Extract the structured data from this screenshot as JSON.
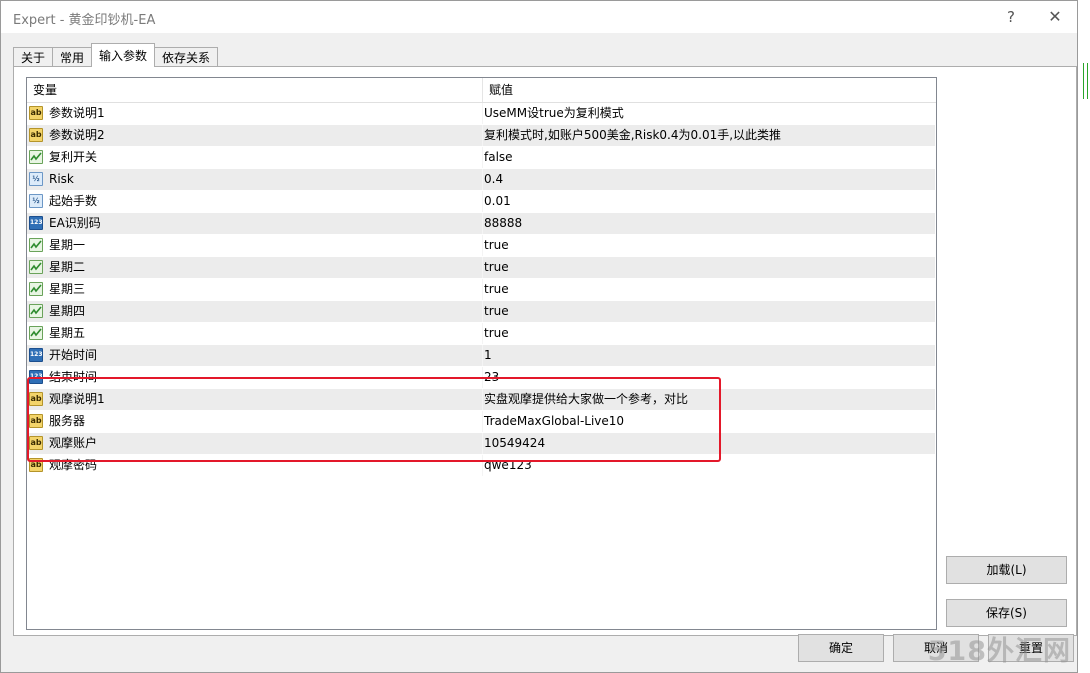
{
  "window": {
    "title": "Expert - 黄金印钞机-EA",
    "help": "?",
    "close": "✕"
  },
  "tabs": [
    {
      "label": "关于",
      "active": false
    },
    {
      "label": "常用",
      "active": false
    },
    {
      "label": "输入参数",
      "active": true
    },
    {
      "label": "依存关系",
      "active": false
    }
  ],
  "table": {
    "headers": {
      "variable": "变量",
      "value": "赋值"
    },
    "rows": [
      {
        "type": "ab-icon",
        "name": "参数说明1",
        "value": "UseMM设true为复利模式"
      },
      {
        "type": "ab-icon",
        "name": "参数说明2",
        "value": "复利模式时,如账户500美金,Risk0.4为0.01手,以此类推"
      },
      {
        "type": "bool-icon",
        "name": "复利开关",
        "value": "false"
      },
      {
        "type": "fraction-icon",
        "name": "Risk",
        "value": "0.4"
      },
      {
        "type": "fraction-icon",
        "name": "起始手数",
        "value": "0.01"
      },
      {
        "type": "integer-icon",
        "name": "EA识别码",
        "value": "88888"
      },
      {
        "type": "bool-icon",
        "name": "星期一",
        "value": "true"
      },
      {
        "type": "bool-icon",
        "name": "星期二",
        "value": "true"
      },
      {
        "type": "bool-icon",
        "name": "星期三",
        "value": "true"
      },
      {
        "type": "bool-icon",
        "name": "星期四",
        "value": "true"
      },
      {
        "type": "bool-icon",
        "name": "星期五",
        "value": "true"
      },
      {
        "type": "integer-icon",
        "name": "开始时间",
        "value": "1"
      },
      {
        "type": "integer-icon",
        "name": "结束时间",
        "value": "23"
      },
      {
        "type": "ab-icon",
        "name": "观摩说明1",
        "value": "实盘观摩提供给大家做一个参考，对比"
      },
      {
        "type": "ab-icon",
        "name": "服务器",
        "value": "TradeMaxGlobal-Live10"
      },
      {
        "type": "ab-icon",
        "name": "观摩账户",
        "value": "10549424"
      },
      {
        "type": "ab-icon",
        "name": "观摩密码",
        "value": "qwe123"
      }
    ]
  },
  "icon_glyphs": {
    "ab-icon": "ab",
    "fraction-icon": "½",
    "integer-icon": "123"
  },
  "buttons": {
    "load": "加载(L)",
    "save": "保存(S)",
    "ok": "确定",
    "cancel": "取消",
    "reset": "重置"
  },
  "watermark": "518外汇网",
  "colors": {
    "highlight": "#e3182a",
    "row_alt": "#ececec"
  }
}
